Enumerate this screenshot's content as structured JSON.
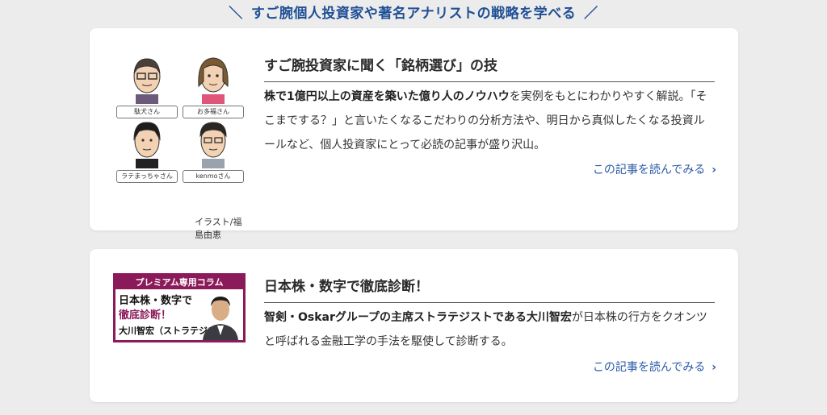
{
  "section_heading": "すご腕個人投資家や著名アナリストの戦略を学べる",
  "heading_slash_left": "＼",
  "heading_slash_right": "／",
  "cards": [
    {
      "title": "すご腕投資家に聞く「銘柄選び」の技",
      "desc_bold": "株で1億円以上の資産を築いた億り人のノウハウ",
      "desc_rest": "を実例をもとにわかりやすく解説。「そこまでする？」と言いたくなるこだわりの分析方法や、明日から真似したくなる投資ルールなど、個人投資家にとって必読の記事が盛り沢山。",
      "read_more": "この記事を読んでみる",
      "people": [
        "駄犬さん",
        "お多福さん",
        "ラテまっちゃさん",
        "kenmoさん"
      ],
      "credit": "イラスト/福島由恵"
    },
    {
      "title": "日本株・数字で徹底診断！",
      "desc_bold": "智剣・Oskarグループの主席ストラテジストである大川智宏",
      "desc_rest": "が日本株の行方をクオンツと呼ばれる金融工学の手法を駆使して診断する。",
      "read_more": "この記事を読んでみる",
      "banner": {
        "top": "プレミアム専用コラム",
        "line1": "日本株・数字で",
        "line2": "徹底診断！",
        "line3": "大川智宏（ストラテジスト）"
      }
    }
  ],
  "colors": {
    "heading": "#1f4f95",
    "link": "#2a5aa8",
    "banner": "#8b1a5a"
  }
}
